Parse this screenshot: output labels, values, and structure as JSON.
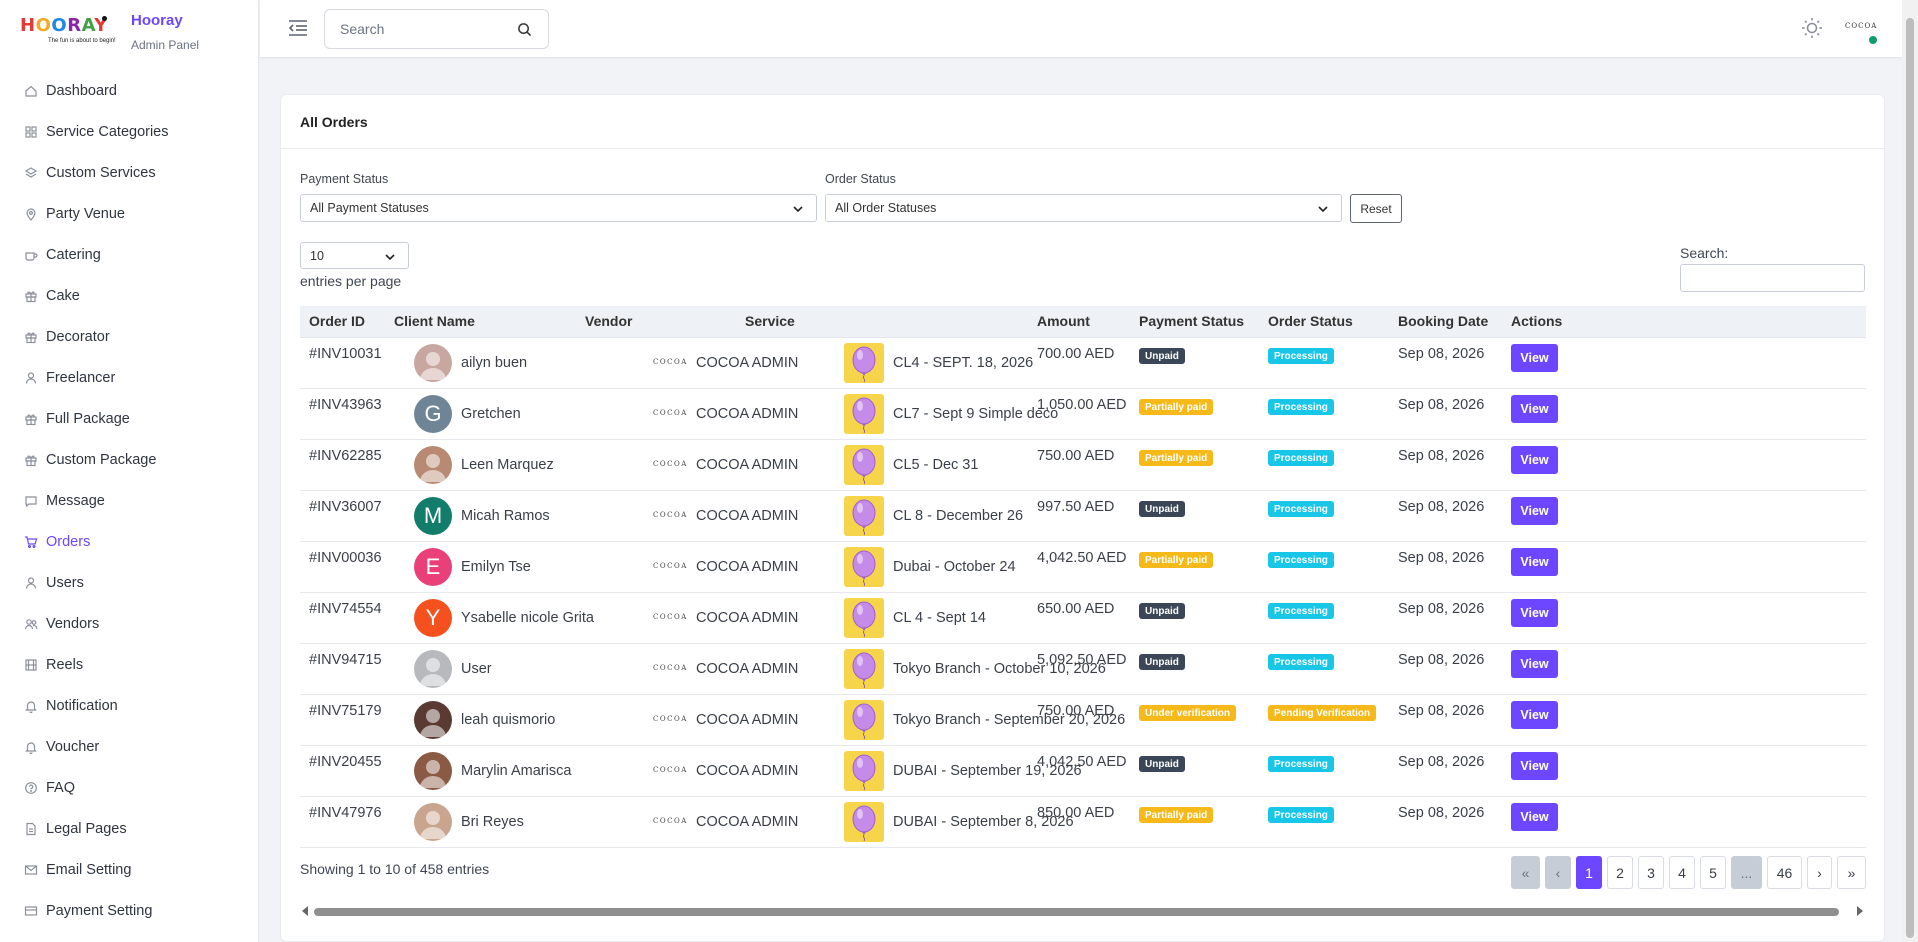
{
  "brand": {
    "logo_text": "HOORAY",
    "logo_tagline": "The fun is about to begin!",
    "name": "Hooray",
    "subtitle": "Admin Panel"
  },
  "sidebar": {
    "items": [
      {
        "label": "Dashboard",
        "icon": "home-icon"
      },
      {
        "label": "Service Categories",
        "icon": "grid-icon"
      },
      {
        "label": "Custom Services",
        "icon": "layers-icon"
      },
      {
        "label": "Party Venue",
        "icon": "map-pin-icon"
      },
      {
        "label": "Catering",
        "icon": "coffee-icon"
      },
      {
        "label": "Cake",
        "icon": "gift-icon"
      },
      {
        "label": "Decorator",
        "icon": "gift-icon"
      },
      {
        "label": "Freelancer",
        "icon": "user-icon"
      },
      {
        "label": "Full Package",
        "icon": "gift-icon"
      },
      {
        "label": "Custom Package",
        "icon": "gift-icon"
      },
      {
        "label": "Message",
        "icon": "message-icon"
      },
      {
        "label": "Orders",
        "icon": "cart-icon",
        "active": true
      },
      {
        "label": "Users",
        "icon": "user-icon"
      },
      {
        "label": "Vendors",
        "icon": "users-icon"
      },
      {
        "label": "Reels",
        "icon": "film-icon"
      },
      {
        "label": "Notification",
        "icon": "bell-icon"
      },
      {
        "label": "Voucher",
        "icon": "bell-icon"
      },
      {
        "label": "FAQ",
        "icon": "help-circle-icon"
      },
      {
        "label": "Legal Pages",
        "icon": "file-icon"
      },
      {
        "label": "Email Setting",
        "icon": "mail-icon"
      },
      {
        "label": "Payment Setting",
        "icon": "credit-card-icon"
      }
    ]
  },
  "topbar": {
    "search_placeholder": "Search",
    "avatar_text": "COCOA"
  },
  "card": {
    "title": "All Orders"
  },
  "filters": {
    "payment_label": "Payment Status",
    "payment_value": "All Payment Statuses",
    "order_label": "Order Status",
    "order_value": "All Order Statuses",
    "reset_label": "Reset"
  },
  "table_controls": {
    "page_size": "10",
    "entries_label": "entries per page",
    "search_label": "Search:"
  },
  "table": {
    "headers": [
      "Order ID",
      "Client Name",
      "Vendor",
      "Service",
      "Amount",
      "Payment Status",
      "Order Status",
      "Booking Date",
      "Actions"
    ],
    "rows": [
      {
        "order_id": "#INV10031",
        "client": "ailyn buen",
        "avatar_letter": "",
        "avatar_color": "#c9a7a1",
        "vendor_logo": "COCOA",
        "vendor": "COCOA ADMIN",
        "service": "CL4 - SEPT. 18, 2026",
        "amount": "700.00 AED",
        "payment": "Unpaid",
        "payment_color": "#3b4656",
        "order": "Processing",
        "order_color": "#18c6e8",
        "date": "Sep 08, 2026",
        "action": "View"
      },
      {
        "order_id": "#INV43963",
        "client": "Gretchen",
        "avatar_letter": "G",
        "avatar_color": "#6f8596",
        "vendor_logo": "COCOA",
        "vendor": "COCOA ADMIN",
        "service": "CL7 - Sept 9 Simple deco",
        "amount": "1,050.00 AED",
        "payment": "Partially paid",
        "payment_color": "#f6b91a",
        "order": "Processing",
        "order_color": "#18c6e8",
        "date": "Sep 08, 2026",
        "action": "View"
      },
      {
        "order_id": "#INV62285",
        "client": "Leen Marquez",
        "avatar_letter": "",
        "avatar_color": "#b88a74",
        "vendor_logo": "COCOA",
        "vendor": "COCOA ADMIN",
        "service": "CL5 - Dec 31",
        "amount": "750.00 AED",
        "payment": "Partially paid",
        "payment_color": "#f6b91a",
        "order": "Processing",
        "order_color": "#18c6e8",
        "date": "Sep 08, 2026",
        "action": "View"
      },
      {
        "order_id": "#INV36007",
        "client": "Micah Ramos",
        "avatar_letter": "M",
        "avatar_color": "#127d6a",
        "vendor_logo": "COCOA",
        "vendor": "COCOA ADMIN",
        "service": "CL 8 - December 26",
        "amount": "997.50 AED",
        "payment": "Unpaid",
        "payment_color": "#3b4656",
        "order": "Processing",
        "order_color": "#18c6e8",
        "date": "Sep 08, 2026",
        "action": "View"
      },
      {
        "order_id": "#INV00036",
        "client": "Emilyn Tse",
        "avatar_letter": "E",
        "avatar_color": "#ea4079",
        "vendor_logo": "COCOA",
        "vendor": "COCOA ADMIN",
        "service": "Dubai - October 24",
        "amount": "4,042.50 AED",
        "payment": "Partially paid",
        "payment_color": "#f6b91a",
        "order": "Processing",
        "order_color": "#18c6e8",
        "date": "Sep 08, 2026",
        "action": "View"
      },
      {
        "order_id": "#INV74554",
        "client": "Ysabelle nicole Grita",
        "avatar_letter": "Y",
        "avatar_color": "#f4511e",
        "vendor_logo": "COCOA",
        "vendor": "COCOA ADMIN",
        "service": "CL 4 - Sept 14",
        "amount": "650.00 AED",
        "payment": "Unpaid",
        "payment_color": "#3b4656",
        "order": "Processing",
        "order_color": "#18c6e8",
        "date": "Sep 08, 2026",
        "action": "View"
      },
      {
        "order_id": "#INV94715",
        "client": "User",
        "avatar_letter": "",
        "avatar_color": "#b7b9bd",
        "vendor_logo": "COCOA",
        "vendor": "COCOA ADMIN",
        "service": "Tokyo Branch - October 10, 2026",
        "amount": "5,092.50 AED",
        "payment": "Unpaid",
        "payment_color": "#3b4656",
        "order": "Processing",
        "order_color": "#18c6e8",
        "date": "Sep 08, 2026",
        "action": "View"
      },
      {
        "order_id": "#INV75179",
        "client": "leah quismorio",
        "avatar_letter": "",
        "avatar_color": "#5a3a33",
        "vendor_logo": "COCOA",
        "vendor": "COCOA ADMIN",
        "service": "Tokyo Branch - September 20, 2026",
        "amount": "750.00 AED",
        "payment": "Under verification",
        "payment_color": "#f6b91a",
        "order": "Pending Verification",
        "order_color": "#f6b91a",
        "date": "Sep 08, 2026",
        "action": "View"
      },
      {
        "order_id": "#INV20455",
        "client": "Marylin Amarisca",
        "avatar_letter": "",
        "avatar_color": "#8a5a44",
        "vendor_logo": "COCOA",
        "vendor": "COCOA ADMIN",
        "service": "DUBAI - September 19, 2026",
        "amount": "4,042.50 AED",
        "payment": "Unpaid",
        "payment_color": "#3b4656",
        "order": "Processing",
        "order_color": "#18c6e8",
        "date": "Sep 08, 2026",
        "action": "View"
      },
      {
        "order_id": "#INV47976",
        "client": "Bri Reyes",
        "avatar_letter": "",
        "avatar_color": "#c9a58f",
        "vendor_logo": "COCOA",
        "vendor": "COCOA ADMIN",
        "service": "DUBAI - September 8, 2026",
        "amount": "850.00 AED",
        "payment": "Partially paid",
        "payment_color": "#f6b91a",
        "order": "Processing",
        "order_color": "#18c6e8",
        "date": "Sep 08, 2026",
        "action": "View"
      }
    ]
  },
  "footer": {
    "showing": "Showing 1 to 10 of 458 entries",
    "pages": [
      "«",
      "‹",
      "1",
      "2",
      "3",
      "4",
      "5",
      "...",
      "46",
      "›",
      "»"
    ],
    "current_page": "1"
  },
  "colors": {
    "accent": "#6c47ff",
    "unpaid": "#3b4656",
    "partial": "#f6b91a",
    "processing": "#18c6e8"
  }
}
